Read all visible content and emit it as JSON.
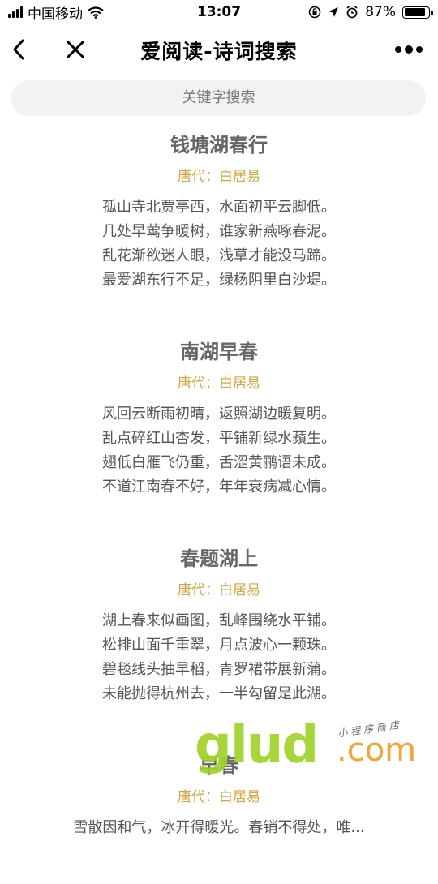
{
  "status_bar": {
    "carrier": "中国移动",
    "time": "13:07",
    "battery_text": "87%",
    "battery_level": 0.87,
    "icons": [
      "signal-icon",
      "wifi-icon",
      "orientation-lock-icon",
      "location-icon",
      "alarm-icon",
      "battery-icon"
    ]
  },
  "nav": {
    "title": "爱阅读-诗词搜索",
    "back_icon": "back-chevron-icon",
    "close_icon": "close-icon",
    "more_icon": "more-dots-icon"
  },
  "search": {
    "placeholder": "关键字搜索"
  },
  "poems": [
    {
      "title": "钱塘湖春行",
      "meta": "唐代：白居易",
      "lines": [
        "孤山寺北贾亭西，水面初平云脚低。",
        "几处早莺争暖树，谁家新燕啄春泥。",
        "乱花渐欲迷人眼，浅草才能没马蹄。",
        "最爱湖东行不足，绿杨阴里白沙堤。"
      ]
    },
    {
      "title": "南湖早春",
      "meta": "唐代：白居易",
      "lines": [
        "风回云断雨初晴，返照湖边暖复明。",
        "乱点碎红山杏发，平铺新绿水蘋生。",
        "翅低白雁飞仍重，舌涩黄鹂语未成。",
        "不道江南春不好，年年衰病减心情。"
      ]
    },
    {
      "title": "春题湖上",
      "meta": "唐代：白居易",
      "lines": [
        "湖上春来似画图，乱峰围绕水平铺。",
        "松排山面千重翠，月点波心一颗珠。",
        "碧毯线头抽早稻，青罗裙带展新蒲。",
        "未能抛得杭州去，一半勾留是此湖。"
      ]
    },
    {
      "title": "早春",
      "meta": "唐代：白居易",
      "lines": [
        "雪散因和气，冰开得暖光。春销不得处，唯..."
      ]
    }
  ],
  "watermark": {
    "brand": "glud",
    "domain": ".com",
    "tagline": "小程序商店"
  },
  "colors": {
    "accent": "#d8a23a",
    "title": "#666666",
    "body": "#555555",
    "search_bg": "#f2f2f2"
  }
}
